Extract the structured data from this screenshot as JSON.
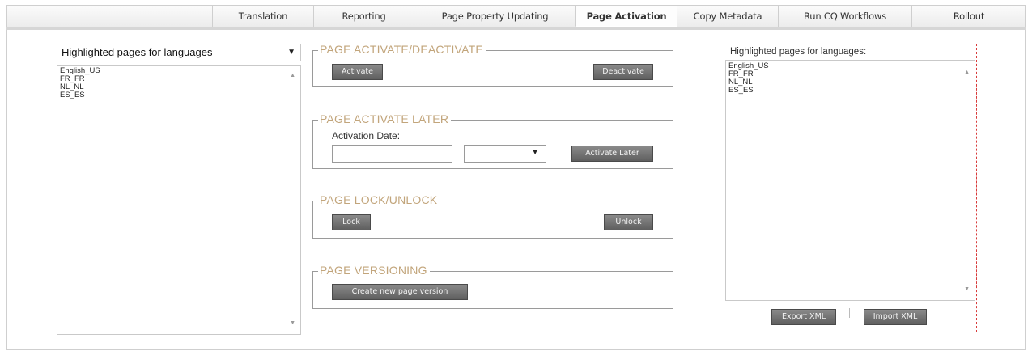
{
  "tabs": [
    {
      "label": "Translation"
    },
    {
      "label": "Reporting"
    },
    {
      "label": "Page Property Updating"
    },
    {
      "label": "Page Activation"
    },
    {
      "label": "Copy Metadata"
    },
    {
      "label": "Run CQ Workflows"
    },
    {
      "label": "Rollout"
    }
  ],
  "active_tab": "Page Activation",
  "left_panel": {
    "select_value": "Highlighted pages for languages",
    "languages": [
      "English_US",
      "FR_FR",
      "NL_NL",
      "ES_ES"
    ]
  },
  "sections": {
    "activate": {
      "legend": "PAGE ACTIVATE/DEACTIVATE",
      "activate_label": "Activate",
      "deactivate_label": "Deactivate"
    },
    "later": {
      "legend": "PAGE ACTIVATE LATER",
      "date_label": "Activation Date:",
      "date_value": "",
      "time_value": "",
      "button_label": "Activate Later"
    },
    "lock": {
      "legend": "PAGE LOCK/UNLOCK",
      "lock_label": "Lock",
      "unlock_label": "Unlock"
    },
    "versioning": {
      "legend": "PAGE VERSIONING",
      "button_label": "Create new page version"
    }
  },
  "right_panel": {
    "title": "Highlighted pages for languages:",
    "languages": [
      "English_US",
      "FR_FR",
      "NL_NL",
      "ES_ES"
    ],
    "export_label": "Export XML",
    "import_label": "Import XML"
  },
  "colors": {
    "legend": "#c2a57b",
    "button": "#6f6f6f",
    "highlight_border": "#d83a3a"
  }
}
